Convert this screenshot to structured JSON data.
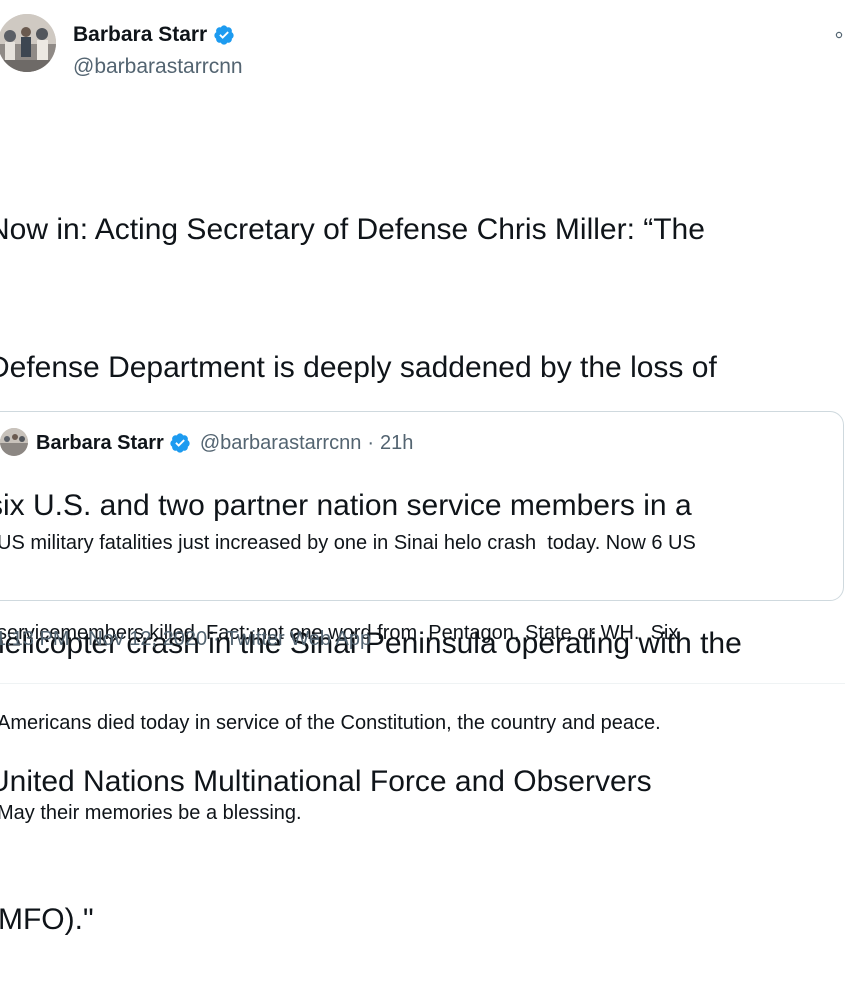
{
  "tweet": {
    "author": {
      "name": "Barbara Starr",
      "handle": "@barbarastarrcnn",
      "verified_icon": "verified-badge-icon",
      "verified_color": "#1d9bf0"
    },
    "more_icon": "more-options-icon",
    "text_lines": [
      "Now in: Acting Secretary of Defense Chris Miller: “The",
      "Defense Department is deeply saddened by the loss of",
      "six U.S. and two partner nation service members in a",
      "helicopter crash in the Sinai Peninsula operating with the",
      "United Nations Multinational Force and Observers",
      "(MFO).\""
    ],
    "quoted_tweet": {
      "name": "Barbara Starr",
      "handle": "@barbarastarrcnn",
      "separator": "·",
      "time": "21h",
      "text_lines": [
        "US military fatalities just increased by one in Sinai helo crash  today. Now 6 US",
        "servicemembers killed. Fact: not one word from  Pentagon, State or WH.  Six",
        "Americans died today in service of the Constitution, the country and peace.",
        "May their memories be a blessing."
      ]
    },
    "meta": {
      "time": "1:13 PM",
      "separator": "·",
      "date": "Nov 12, 2020",
      "source": "Twitter Web App"
    }
  }
}
